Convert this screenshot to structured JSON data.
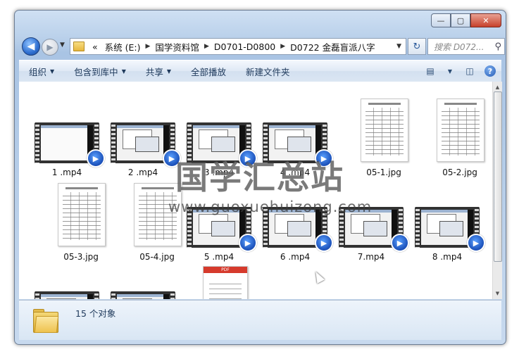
{
  "window": {
    "buttons": {
      "minimize": "—",
      "maximize": "▢",
      "close": "✕"
    }
  },
  "nav": {
    "back_icon": "back-arrow-icon",
    "forward_icon": "forward-arrow-icon",
    "address": {
      "overflow": "«",
      "crumbs": [
        "系统 (E:)",
        "国学资料馆",
        "D0701-D0800",
        "D0722 金磊盲派八字"
      ]
    },
    "search_placeholder": "搜索 D072..."
  },
  "toolbar": {
    "organize": "组织",
    "include_library": "包含到库中",
    "share": "共享",
    "play_all": "全部播放",
    "new_folder": "新建文件夹"
  },
  "files": [
    {
      "name": "1 .mp4",
      "type": "video"
    },
    {
      "name": "2 .mp4",
      "type": "video"
    },
    {
      "name": "3 .mp4",
      "type": "video"
    },
    {
      "name": "4 .mp4",
      "type": "video"
    },
    {
      "name": "05-1.jpg",
      "type": "image"
    },
    {
      "name": "05-2.jpg",
      "type": "image"
    },
    {
      "name": "05-3.jpg",
      "type": "image"
    },
    {
      "name": "05-4.jpg",
      "type": "image"
    },
    {
      "name": "5 .mp4",
      "type": "video"
    },
    {
      "name": "6 .mp4",
      "type": "video"
    },
    {
      "name": "7.mp4",
      "type": "video"
    },
    {
      "name": "8 .mp4",
      "type": "video"
    },
    {
      "name": "",
      "type": "video"
    },
    {
      "name": "",
      "type": "video"
    },
    {
      "name": "",
      "type": "pdf"
    }
  ],
  "pdf_badge": "PDF",
  "watermark": {
    "cn": "国学汇总站",
    "url": "www.guoxuehuizong.com"
  },
  "status": {
    "count_text": "15 个对象"
  }
}
